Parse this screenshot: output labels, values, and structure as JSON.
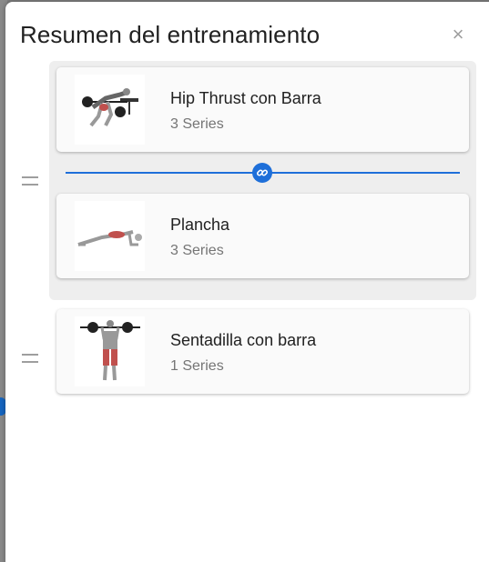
{
  "modal": {
    "title": "Resumen del entrenamiento",
    "close_symbol": "×"
  },
  "superset": {
    "exercises": [
      {
        "name": "Hip Thrust con Barra",
        "sets": "3 Series",
        "image_icon": "hip-thrust-figure"
      },
      {
        "name": "Plancha",
        "sets": "3 Series",
        "image_icon": "plank-figure"
      }
    ],
    "link_icon": "link-icon",
    "accent_color": "#1e6fd9"
  },
  "single": {
    "exercises": [
      {
        "name": "Sentadilla con barra",
        "sets": "1 Series",
        "image_icon": "barbell-squat-figure"
      }
    ]
  }
}
